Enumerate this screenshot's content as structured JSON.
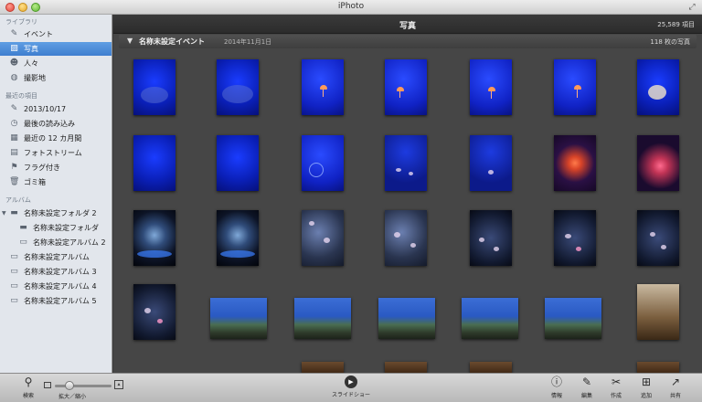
{
  "window": {
    "title": "iPhoto"
  },
  "sidebar": {
    "library_header": "ライブラリ",
    "library_items": [
      {
        "label": "イベント",
        "icon": "events-icon"
      },
      {
        "label": "写真",
        "icon": "photos-icon",
        "selected": true
      },
      {
        "label": "人々",
        "icon": "faces-icon"
      },
      {
        "label": "撮影地",
        "icon": "places-icon"
      }
    ],
    "recent_header": "最近の項目",
    "recent_items": [
      {
        "label": "2013/10/17",
        "icon": "event-date-icon"
      },
      {
        "label": "最後の読み込み",
        "icon": "last-import-icon"
      },
      {
        "label": "最近の 12 カ月間",
        "icon": "calendar-icon"
      },
      {
        "label": "フォトストリーム",
        "icon": "photostream-icon"
      },
      {
        "label": "フラグ付き",
        "icon": "flag-icon"
      },
      {
        "label": "ゴミ箱",
        "icon": "trash-icon"
      }
    ],
    "album_header": "アルバム",
    "album_items": [
      {
        "label": "名称未設定フォルダ 2",
        "icon": "folder-icon",
        "level": 0,
        "expanded": true
      },
      {
        "label": "名称未設定フォルダ",
        "icon": "folder-icon",
        "level": 1
      },
      {
        "label": "名称未設定アルバム 2",
        "icon": "album-icon",
        "level": 1
      },
      {
        "label": "名称未設定アルバム",
        "icon": "album-icon",
        "level": 0
      },
      {
        "label": "名称未設定アルバム 3",
        "icon": "album-icon",
        "level": 0
      },
      {
        "label": "名称未設定アルバム 4",
        "icon": "album-icon",
        "level": 0
      },
      {
        "label": "名称未設定アルバム 5",
        "icon": "album-icon",
        "level": 0
      }
    ]
  },
  "main": {
    "title": "写真",
    "item_count": "25,589 項目",
    "event": {
      "name": "名称未設定イベント",
      "date": "2014年11月1日",
      "photo_count": "118 枚の写真"
    }
  },
  "toolbar": {
    "search_label": "検索",
    "zoom_label": "拡大／縮小",
    "slideshow_label": "スライドショー",
    "info_label": "情報",
    "edit_label": "編集",
    "create_label": "作成",
    "add_label": "追加",
    "share_label": "共有"
  }
}
